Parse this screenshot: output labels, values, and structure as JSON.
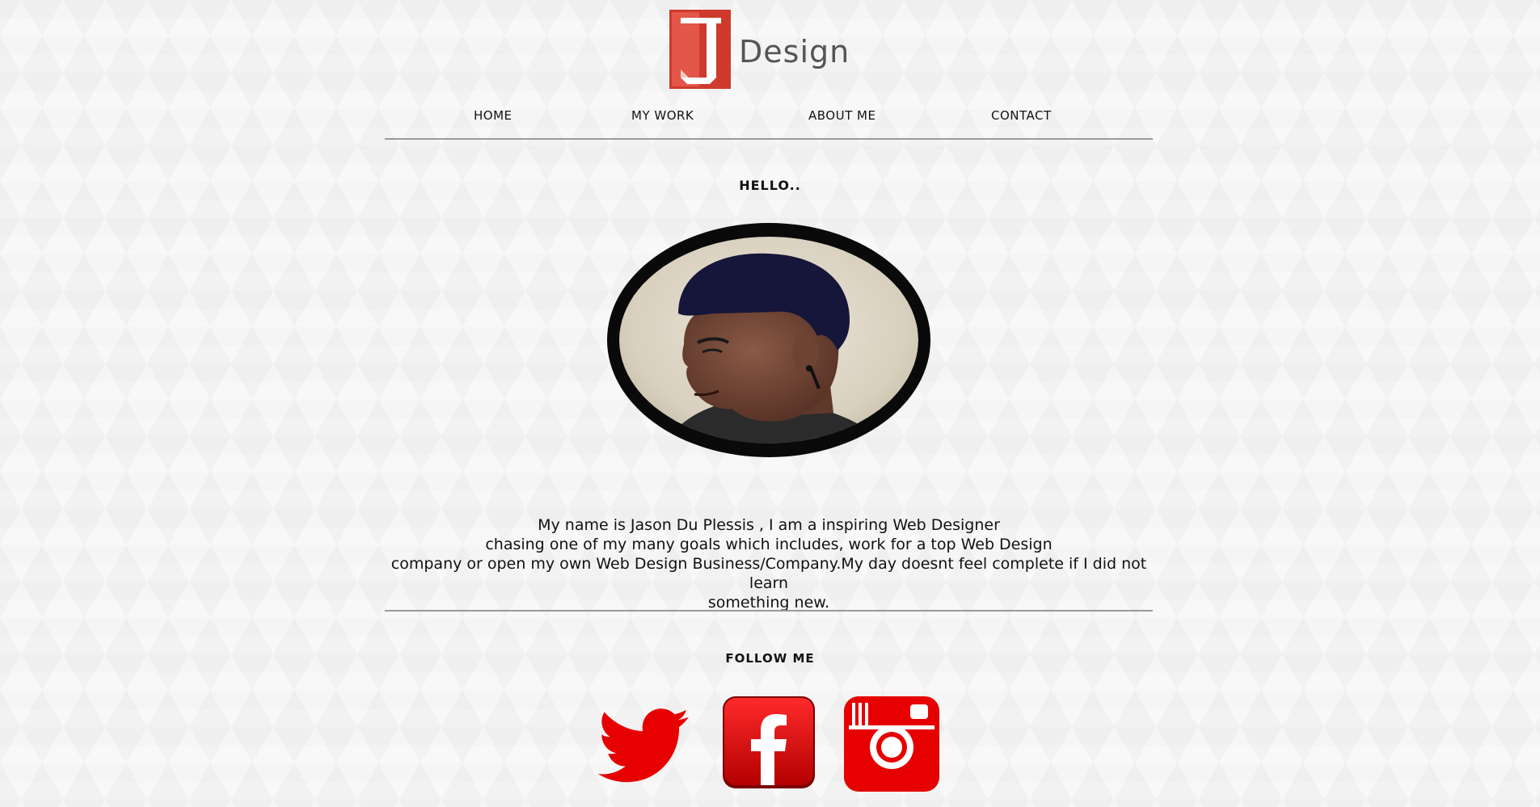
{
  "brand": {
    "logo_letter": "J",
    "logo_text": "Design"
  },
  "nav": {
    "items": [
      {
        "label": "HOME"
      },
      {
        "label": "MY WORK"
      },
      {
        "label": "ABOUT ME"
      },
      {
        "label": "CONTACT"
      }
    ]
  },
  "intro": {
    "greeting": "HELLO..",
    "portrait_icon": "profile-photo",
    "bio_lines": [
      "My name is Jason Du Plessis , I am a inspiring Web Designer",
      "chasing one of my many goals which includes, work for a top Web Design",
      "company or open my own Web Design Business/Company.My day doesnt feel complete if I did not learn",
      "something new."
    ]
  },
  "social": {
    "heading": "FOLLOW ME",
    "links": [
      {
        "icon": "twitter-icon"
      },
      {
        "icon": "facebook-icon"
      },
      {
        "icon": "instagram-icon"
      }
    ]
  },
  "colors": {
    "brand_red": "#e60000",
    "logo_red": "#d9402f",
    "rule_gray": "#9a9a9a"
  }
}
